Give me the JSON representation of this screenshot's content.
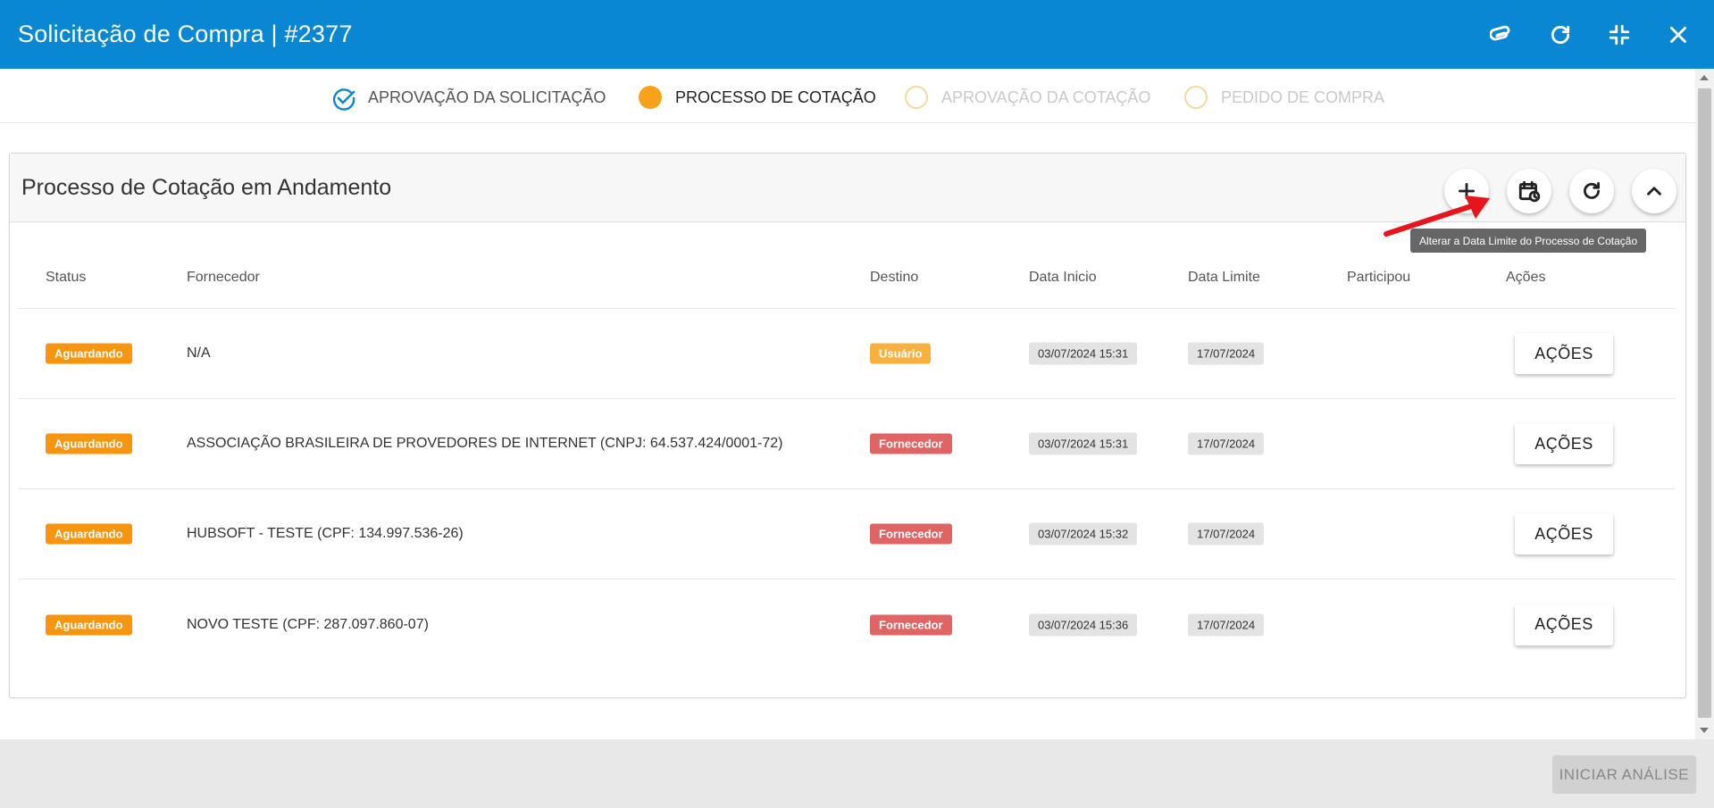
{
  "window": {
    "title": "Solicitação de Compra | #2377",
    "header_colors": {
      "bg": "#0a87d2"
    }
  },
  "header_actions": [
    "paperclip-icon",
    "refresh-icon",
    "minimize-icon",
    "close-icon"
  ],
  "stepper": {
    "steps": [
      {
        "label": "APROVAÇÃO DA SOLICITAÇÃO",
        "state": "done"
      },
      {
        "label": "PROCESSO DE COTAÇÃO",
        "state": "active"
      },
      {
        "label": "APROVAÇÃO DA COTAÇÃO",
        "state": "pending"
      },
      {
        "label": "PEDIDO DE COMPRA",
        "state": "pending"
      }
    ]
  },
  "card": {
    "title": "Processo de Cotação em Andamento",
    "actions": [
      "plus-icon",
      "calendar-clock-icon",
      "refresh-icon",
      "chevron-up-icon"
    ],
    "tooltip": "Alterar a Data Limite do Processo de Cotação"
  },
  "table": {
    "headers": {
      "status": "Status",
      "fornecedor": "Fornecedor",
      "destino": "Destino",
      "data_inicio": "Data Inicio",
      "data_limite": "Data Limite",
      "participou": "Participou",
      "acoes": "Ações"
    },
    "rows": [
      {
        "status": "Aguardando",
        "fornecedor": "N/A",
        "destino": "Usuário",
        "data_inicio": "03/07/2024 15:31",
        "data_limite": "17/07/2024",
        "participou": "",
        "acoes": "AÇÕES"
      },
      {
        "status": "Aguardando",
        "fornecedor": "ASSOCIAÇÃO BRASILEIRA DE PROVEDORES DE INTERNET (CNPJ: 64.537.424/0001-72)",
        "destino": "Fornecedor",
        "data_inicio": "03/07/2024 15:31",
        "data_limite": "17/07/2024",
        "participou": "",
        "acoes": "AÇÕES"
      },
      {
        "status": "Aguardando",
        "fornecedor": "HUBSOFT - TESTE (CPF: 134.997.536-26)",
        "destino": "Fornecedor",
        "data_inicio": "03/07/2024 15:32",
        "data_limite": "17/07/2024",
        "participou": "",
        "acoes": "AÇÕES"
      },
      {
        "status": "Aguardando",
        "fornecedor": "NOVO TESTE (CPF: 287.097.860-07)",
        "destino": "Fornecedor",
        "data_inicio": "03/07/2024 15:36",
        "data_limite": "17/07/2024",
        "participou": "",
        "acoes": "AÇÕES"
      }
    ]
  },
  "footer": {
    "primary_label": "INICIAR ANÁLISE"
  },
  "colors": {
    "accent": "#0a87d2",
    "status_orange": "#f7950f",
    "usuario_badge": "#f8b13c",
    "fornecedor_badge": "#e06464"
  }
}
